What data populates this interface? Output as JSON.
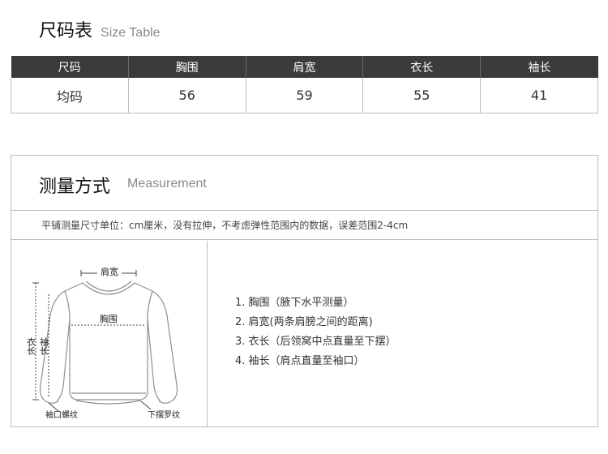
{
  "size_table": {
    "title_zh": "尺码表",
    "title_en": "Size Table",
    "headers": [
      "尺码",
      "胸围",
      "肩宽",
      "衣长",
      "袖长"
    ],
    "row": [
      "均码",
      "56",
      "59",
      "55",
      "41"
    ]
  },
  "measurement": {
    "title_zh": "测量方式",
    "title_en": "Measurement",
    "note": "平铺测量尺寸单位：cm厘米，没有拉伸，不考虑弹性范围内的数据，误差范围2-4cm",
    "diagram_labels": {
      "shoulder": "肩宽",
      "chest": "胸围",
      "body_length": "衣长",
      "sleeve_length": "袖长",
      "cuff": "袖口螺纹",
      "hem": "下摆罗纹"
    },
    "items": [
      "1. 胸围（腋下水平测量）",
      "2. 肩宽(两条肩膀之间的距离)",
      "3. 衣长（后领窝中点直量至下摆）",
      "4. 袖长（肩点直量至袖口）"
    ]
  }
}
